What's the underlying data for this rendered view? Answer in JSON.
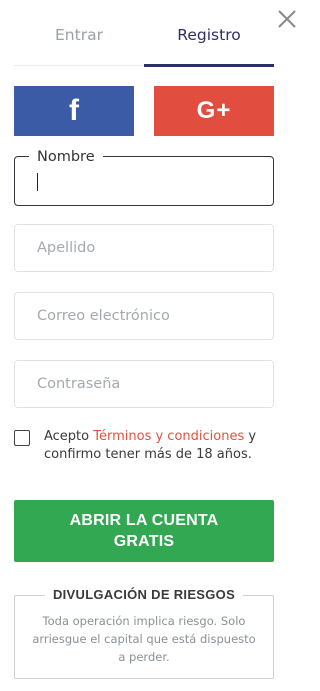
{
  "tabs": {
    "login_label": "Entrar",
    "register_label": "Registro",
    "active": "Registro"
  },
  "social": {
    "facebook_label": "f",
    "google_label": "G+"
  },
  "form": {
    "first_name": {
      "label": "Nombre",
      "value": ""
    },
    "last_name": {
      "placeholder": "Apellido",
      "value": ""
    },
    "email": {
      "placeholder": "Correo electrónico",
      "value": ""
    },
    "password": {
      "placeholder": "Contraseña",
      "value": ""
    }
  },
  "terms": {
    "prefix": "Acepto ",
    "link": "Términos y condiciones",
    "suffix": " y confirmo tener más de 18 años.",
    "checked": false
  },
  "submit": {
    "label": "ABRIR LA CUENTA GRATIS"
  },
  "risk": {
    "title": "DIVULGACIÓN DE RIESGOS",
    "text": "Toda operación implica riesgo. Solo arriesgue el capital que está dispuesto a perder."
  },
  "colors": {
    "facebook": "#3b5ba6",
    "google": "#e14d3e",
    "accent": "#2b2f6b",
    "submit": "#33a853",
    "link": "#e2523f"
  }
}
